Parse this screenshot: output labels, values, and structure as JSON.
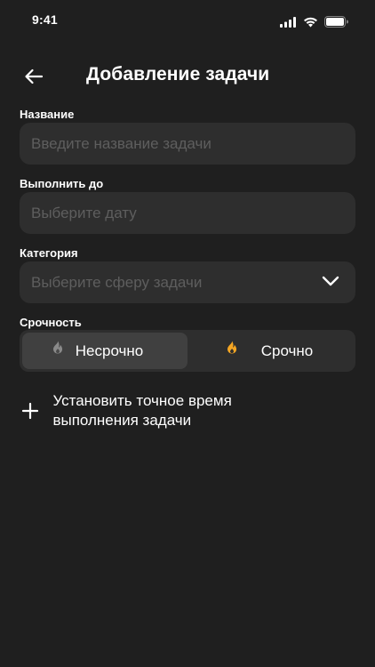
{
  "status_bar": {
    "time": "9:41"
  },
  "header": {
    "title": "Добавление задачи"
  },
  "fields": {
    "name": {
      "label": "Название",
      "placeholder": "Введите название задачи"
    },
    "due": {
      "label": "Выполнить до",
      "placeholder": "Выберите дату"
    },
    "category": {
      "label": "Категория",
      "placeholder": "Выберите сферу задачи"
    }
  },
  "urgency": {
    "label": "Срочность",
    "options": [
      {
        "label": "Несрочно",
        "selected": true,
        "icon": "flame-gray-icon"
      },
      {
        "label": "Срочно",
        "selected": false,
        "icon": "flame-orange-icon"
      }
    ]
  },
  "add_time": {
    "label": "Установить точное время выполнения задачи"
  },
  "colors": {
    "background": "#1f1f1f",
    "field": "#2e2e2e",
    "accent": "#f5a623"
  }
}
